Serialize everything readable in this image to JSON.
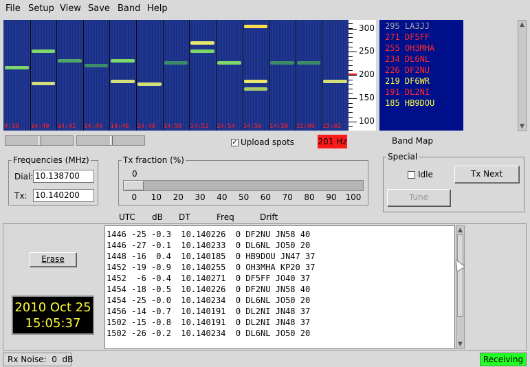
{
  "menu": [
    "File",
    "Setup",
    "View",
    "Save",
    "Band",
    "Help"
  ],
  "waterfall": {
    "times": [
      "4:38",
      "14:40",
      "14:42",
      "14:44",
      "14:46",
      "14:48",
      "14:50",
      "14:52",
      "14:54",
      "14:56",
      "14:58",
      "15:00",
      "15:02"
    ],
    "scale_ticks": [
      "300",
      "250",
      "200",
      "150",
      "100"
    ]
  },
  "band_map": {
    "entries": [
      {
        "text": "295 LA3JJ",
        "color": "#a8a8a8"
      },
      {
        "text": "271 DF5FF",
        "color": "#ff2a2a"
      },
      {
        "text": "255 OH3MHA",
        "color": "#ff2a2a"
      },
      {
        "text": "234 DL6NL",
        "color": "#ff2a2a"
      },
      {
        "text": "226 DF2NU",
        "color": "#ff2a2a"
      },
      {
        "text": "219 DF6WR",
        "color": "#ffff44"
      },
      {
        "text": "191 DL2NI",
        "color": "#ff2a2a"
      },
      {
        "text": "185 HB9DOU",
        "color": "#ffff44"
      }
    ],
    "label": "Band Map"
  },
  "upload_spots": {
    "label": "Upload spots",
    "checked": true
  },
  "freq_indicator": "201 Hz",
  "frequencies": {
    "legend": "Frequencies (MHz)",
    "dial_label": "Dial:",
    "dial_value": "10.138700",
    "tx_label": "Tx:",
    "tx_value": "10.140200"
  },
  "tx_fraction": {
    "legend": "Tx fraction (%)",
    "value": "0",
    "value_fraction": 0.0,
    "scale": [
      "0",
      "10",
      "20",
      "30",
      "40",
      "50",
      "60",
      "70",
      "80",
      "90",
      "100"
    ]
  },
  "special": {
    "legend": "Special",
    "idle_label": "Idle",
    "tx_next_label": "Tx Next",
    "tune_label": "Tune"
  },
  "decode": {
    "headers": [
      "UTC",
      "dB",
      "DT",
      "Freq",
      "Drift"
    ],
    "lines": [
      "1446 -25 -0.3  10.140226  0 DF2NU JN58 40",
      "1446 -27 -0.1  10.140233  0 DL6NL JO50 20",
      "1448 -16  0.4  10.140185  0 HB9DOU JN47 37",
      "1452 -19 -0.9  10.140255  0 OH3MHA KP20 37",
      "1452  -6 -0.4  10.140271  0 DF5FF JO40 37",
      "1454 -18 -0.5  10.140226  0 DF2NU JN58 40",
      "1454 -25 -0.0  10.140234  0 DL6NL JO50 20",
      "1456 -14 -0.7  10.140191  0 DL2NI JN48 37",
      "1502 -15 -0.8  10.140191  0 DL2NI JN48 37",
      "1502 -26 -0.2  10.140234  0 DL6NL JO50 20"
    ]
  },
  "erase_label": "Erase",
  "clock": {
    "date": "2010 Oct 25",
    "time": "15:05:37"
  },
  "status": {
    "rx_noise": "Rx Noise:  0  dB",
    "state": "Receiving"
  },
  "colors": {
    "waterfall_bg": "#1c2f88",
    "band_map_bg": "#000f8a",
    "receiving": "#22ff22",
    "freq_indicator": "#ff1a1a"
  }
}
